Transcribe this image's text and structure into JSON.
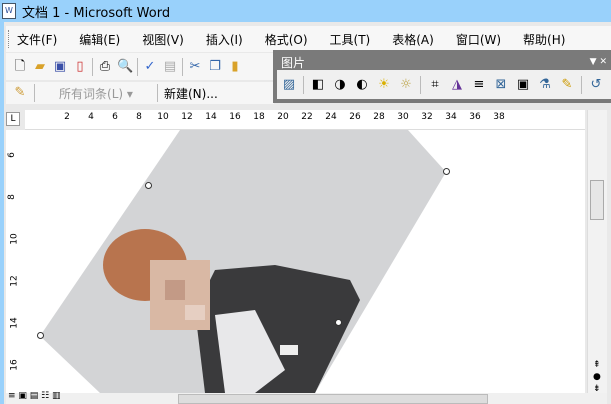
{
  "window": {
    "title": "文档 1 - Microsoft Word"
  },
  "menu": [
    "文件(F)",
    "编辑(E)",
    "视图(V)",
    "插入(I)",
    "格式(O)",
    "工具(T)",
    "表格(A)",
    "窗口(W)",
    "帮助(H)"
  ],
  "toolbar2": {
    "autotext": "所有词条(L) ▾",
    "new_label": "新建(N)..."
  },
  "picture_toolbar": {
    "title": "图片"
  },
  "ruler": {
    "h_ticks": [
      "2",
      "4",
      "6",
      "8",
      "10",
      "12",
      "14",
      "16",
      "18",
      "20",
      "22",
      "24",
      "26",
      "28",
      "30",
      "32",
      "34",
      "36",
      "38"
    ],
    "v_ticks": [
      "6",
      "8",
      "10",
      "12",
      "14",
      "16"
    ]
  }
}
